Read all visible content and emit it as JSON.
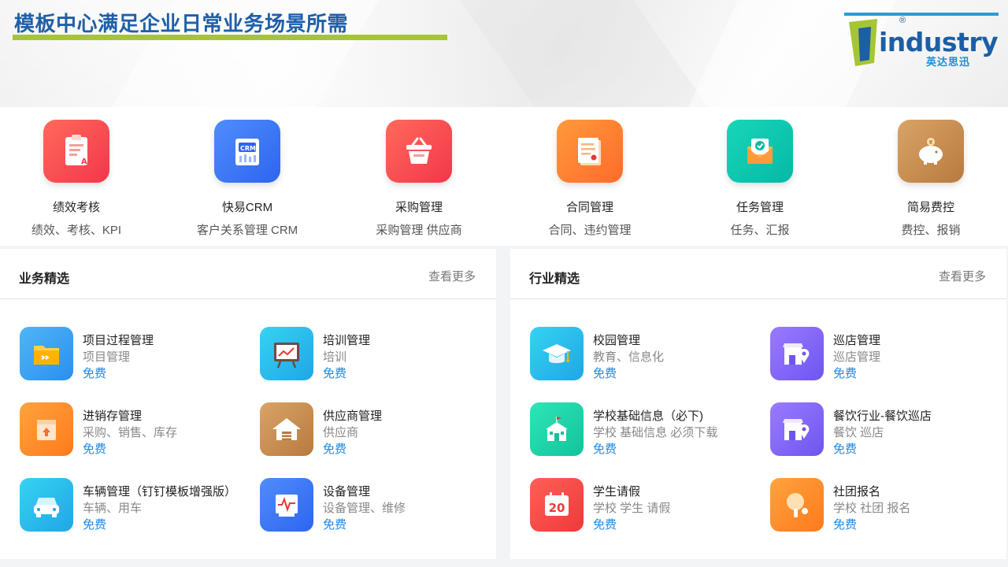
{
  "slide": {
    "title": "模板中心满足企业日常业务场景所需",
    "logo_word": "industry",
    "logo_reg": "®",
    "logo_cn": "英达思迅"
  },
  "top_apps": [
    {
      "name": "绩效考核",
      "desc": "绩效、考核、KPI",
      "icon": "clipboard-icon"
    },
    {
      "name": "快易CRM",
      "desc": "客户关系管理 CRM",
      "icon": "crm-icon"
    },
    {
      "name": "采购管理",
      "desc": "采购管理 供应商",
      "icon": "basket-icon"
    },
    {
      "name": "合同管理",
      "desc": "合同、违约管理",
      "icon": "contract-icon"
    },
    {
      "name": "任务管理",
      "desc": "任务、汇报",
      "icon": "envelope-check-icon"
    },
    {
      "name": "简易费控",
      "desc": "费控、报销",
      "icon": "piggy-bank-icon"
    }
  ],
  "business": {
    "title": "业务精选",
    "more": "查看更多",
    "items": [
      {
        "name": "项目过程管理",
        "desc": "项目管理",
        "price": "免费",
        "icon": "folder-icon"
      },
      {
        "name": "培训管理",
        "desc": "培训",
        "price": "免费",
        "icon": "presentation-board-icon"
      },
      {
        "name": "进销存管理",
        "desc": "采购、销售、库存",
        "price": "免费",
        "icon": "package-icon"
      },
      {
        "name": "供应商管理",
        "desc": "供应商",
        "price": "免费",
        "icon": "warehouse-icon"
      },
      {
        "name": "车辆管理（钉钉模板增强版）",
        "desc": "车辆、用车",
        "price": "免费",
        "icon": "car-icon"
      },
      {
        "name": "设备管理",
        "desc": "设备管理、维修",
        "price": "免费",
        "icon": "device-monitor-icon"
      }
    ]
  },
  "industry": {
    "title": "行业精选",
    "more": "查看更多",
    "items": [
      {
        "name": "校园管理",
        "desc": "教育、信息化",
        "price": "免费",
        "icon": "graduation-cap-icon"
      },
      {
        "name": "巡店管理",
        "desc": "巡店管理",
        "price": "免费",
        "icon": "store-pin-icon"
      },
      {
        "name": "学校基础信息（必下)",
        "desc": "学校 基础信息 必须下载",
        "price": "免费",
        "icon": "school-building-icon"
      },
      {
        "name": "餐饮行业-餐饮巡店",
        "desc": "餐饮 巡店",
        "price": "免费",
        "icon": "store-pin-icon"
      },
      {
        "name": "学生请假",
        "desc": "学校 学生 请假",
        "price": "免费",
        "icon": "calendar-icon"
      },
      {
        "name": "社团报名",
        "desc": "学校 社团 报名",
        "price": "免费",
        "icon": "ping-pong-icon"
      }
    ],
    "calendar_day": "20"
  }
}
